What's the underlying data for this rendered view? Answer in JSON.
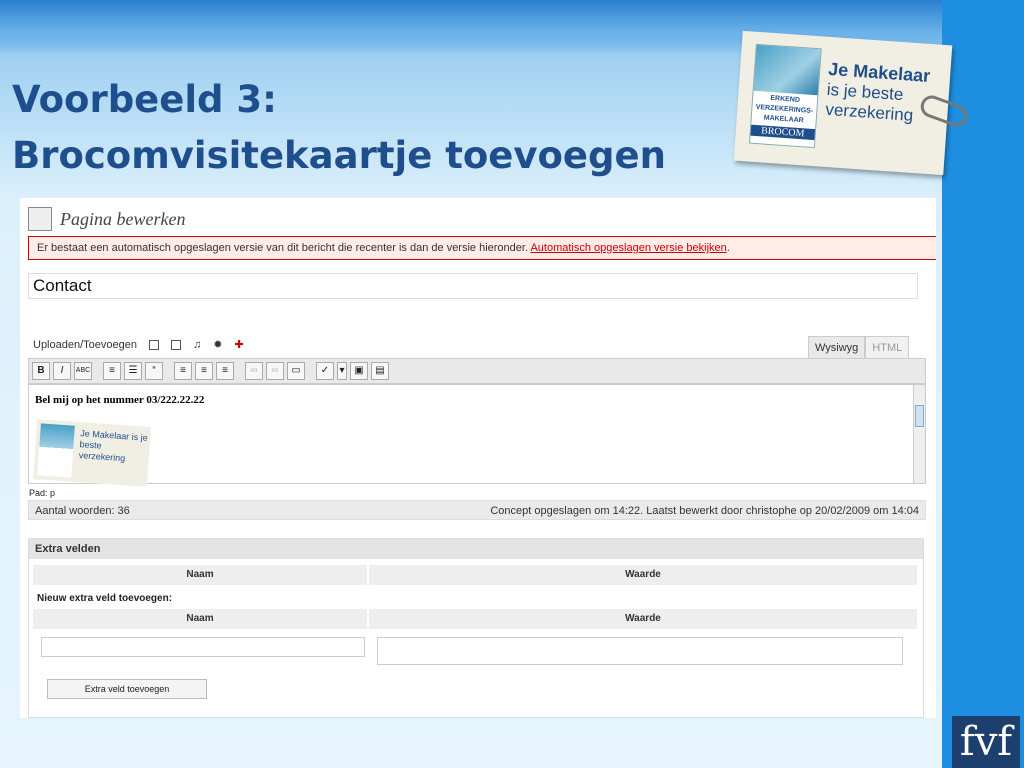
{
  "slide": {
    "title_line1": "Voorbeeld 3:",
    "title_line2": "Brocomvisitekaartje toevoegen"
  },
  "card": {
    "slogan_line1": "Je Makelaar",
    "slogan_line2": "is je beste",
    "slogan_line3": "verzekering",
    "logo_text": "ERKEND VERZEKERINGS-MAKELAAR",
    "brand": "BROCOM"
  },
  "editor": {
    "page_heading": "Pagina bewerken",
    "notice_text": "Er bestaat een automatisch opgeslagen versie van dit bericht die recenter is dan de versie hieronder. ",
    "notice_link": "Automatisch opgeslagen versie bekijken",
    "notice_end": ".",
    "post_title": "Contact",
    "upload_label": "Uploaden/Toevoegen",
    "tab_visual": "Wysiwyg",
    "tab_html": "HTML",
    "content_line": "Bel mij op het nummer 03/222.22.22",
    "mini_slogan": "Je Makelaar is je beste verzekering",
    "path": "Pad: p",
    "word_count": "Aantal woorden: 36",
    "draft_status": "Concept opgeslagen om 14:22. Laatst bewerkt door christophe op 20/02/2009 om 14:04"
  },
  "custom_fields": {
    "heading": "Extra velden",
    "col_name": "Naam",
    "col_value": "Waarde",
    "new_label": "Nieuw extra veld toevoegen:",
    "add_button": "Extra veld toevoegen"
  },
  "footer_logo": "fvf"
}
